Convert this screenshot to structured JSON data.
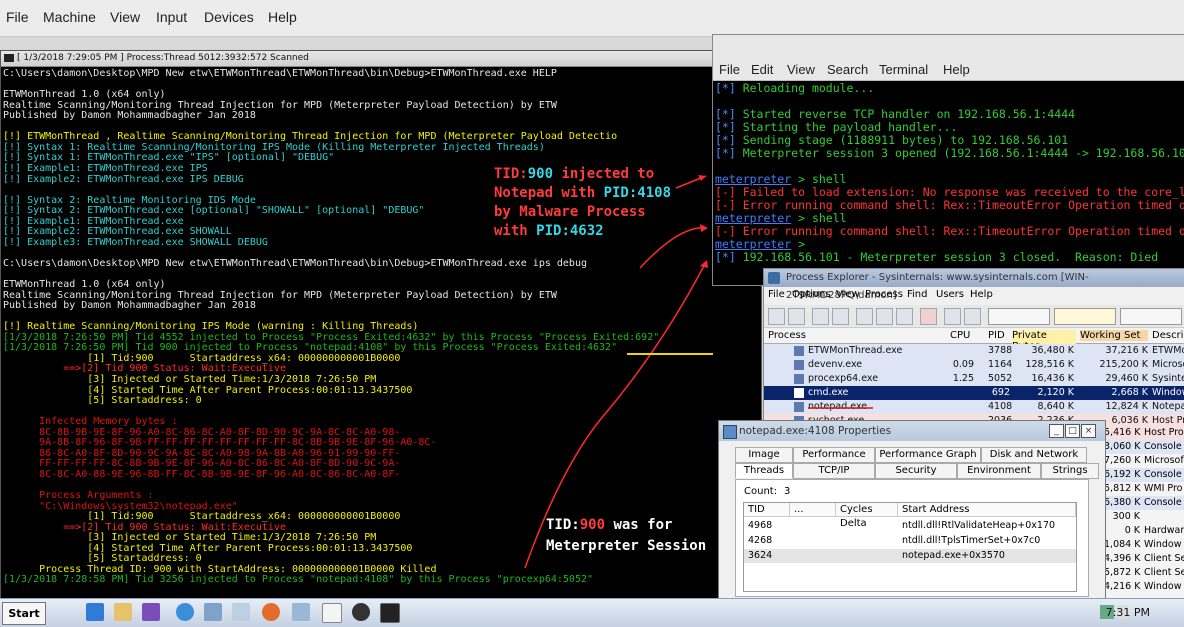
{
  "host_menu": [
    "File",
    "Machine",
    "View",
    "Input",
    "Devices",
    "Help"
  ],
  "cmd": {
    "title": "[ 1/3/2018 7:29:05 PM ] Process:Thread 5012:3932:572 Scanned",
    "lines": [
      {
        "t": "C:\\Users\\damon\\Desktop\\MPD New etw\\ETWMonThread\\ETWMonThread\\bin\\Debug>ETWMonThread.exe HELP",
        "c": "w"
      },
      {
        "t": "",
        "c": "w"
      },
      {
        "t": "ETWMonThread 1.0 (x64 only)",
        "c": "w"
      },
      {
        "t": "Realtime Scanning/Monitoring Thread Injection for MPD (Meterpreter Payload Detection) by ETW",
        "c": "w"
      },
      {
        "t": "Published by Damon Mohammadbagher Jan 2018",
        "c": "w"
      },
      {
        "t": "",
        "c": "w"
      },
      {
        "t": "[!] ETWMonThread , Realtime Scanning/Monitoring Thread Injection for MPD (Meterpreter Payload Detectio",
        "c": "y"
      },
      {
        "t": "[!] Syntax 1: Realtime Scanning/Monitoring IPS Mode (Killing Meterpreter Injected Threads)",
        "c": "c"
      },
      {
        "t": "[!] Syntax 1: ETWMonThread.exe \"IPS\" [optional] \"DEBUG\"",
        "c": "c"
      },
      {
        "t": "[!] Example1: ETWMonThread.exe IPS",
        "c": "c"
      },
      {
        "t": "[!] Example2: ETWMonThread.exe IPS DEBUG",
        "c": "c"
      },
      {
        "t": "",
        "c": "w"
      },
      {
        "t": "[!] Syntax 2: Realtime Monitoring IDS Mode",
        "c": "c"
      },
      {
        "t": "[!] Syntax 2: ETWMonThread.exe [optional] \"SHOWALL\" [optional] \"DEBUG\"",
        "c": "c"
      },
      {
        "t": "[!] Example1: ETWMonThread.exe",
        "c": "c"
      },
      {
        "t": "[!] Example2: ETWMonThread.exe SHOWALL",
        "c": "c"
      },
      {
        "t": "[!] Example3: ETWMonThread.exe SHOWALL DEBUG",
        "c": "c"
      },
      {
        "t": "",
        "c": "w"
      },
      {
        "t": "C:\\Users\\damon\\Desktop\\MPD New etw\\ETWMonThread\\ETWMonThread\\bin\\Debug>ETWMonThread.exe ips debug",
        "c": "w"
      },
      {
        "t": "",
        "c": "w"
      },
      {
        "t": "ETWMonThread 1.0 (x64 only)",
        "c": "w"
      },
      {
        "t": "Realtime Scanning/Monitoring Thread Injection for MPD (Meterpreter Payload Detection) by ETW",
        "c": "w"
      },
      {
        "t": "Published by Damon Mohammadbagher Jan 2018",
        "c": "w"
      },
      {
        "t": "",
        "c": "w"
      },
      {
        "t": "[!] Realtime Scanning/Monitoring IPS Mode (warning : Killing Threads)",
        "c": "y"
      },
      {
        "t": "[1/3/2018 7:26:50 PM] Tid 4552 injected to Process \"Process Exited:4632\" by this Process \"Process Exited:692\"",
        "c": "g"
      },
      {
        "t": "[1/3/2018 7:26:50 PM] Tid 900 injected to Process \"notepad:4108\" by this Process \"Process Exited:4632\"",
        "c": "g"
      },
      {
        "t": "              [1] Tid:900      Startaddress_x64: 000000000001B0000",
        "c": "y"
      },
      {
        "t": "          ==>[2] Tid 900 Status: Wait:Executive",
        "c": "r"
      },
      {
        "t": "              [3] Injected or Started Time:1/3/2018 7:26:50 PM",
        "c": "y"
      },
      {
        "t": "              [4] Started Time After Parent Process:00:01:13.3437500",
        "c": "y"
      },
      {
        "t": "              [5] Startaddress: 0",
        "c": "y"
      },
      {
        "t": "",
        "c": "w"
      },
      {
        "t": "      Infected Memory bytes :",
        "c": "rd"
      },
      {
        "t": "      8C-8B-9B-9E-8F-96-A0-8C-86-8C-A0-8F-8D-90-9C-9A-8C-8C-A0-98-",
        "c": "rd"
      },
      {
        "t": "      9A-8B-8F-96-8F-9B-FF-FF-FF-FF-FF-FF-FF-FF-8C-8B-9B-9E-8F-96-A0-8C-",
        "c": "rd"
      },
      {
        "t": "      86-8C-A0-8F-8D-90-9C-9A-8C-8C-A0-98-9A-8B-A0-96-91-99-90-FF-",
        "c": "rd"
      },
      {
        "t": "      FF-FF-FF-FF-8C-8B-9B-9E-8F-96-A0-8C-86-8C-A0-8F-8D-90-9C-9A-",
        "c": "rd"
      },
      {
        "t": "      8C-8C-A0-88-9E-96-8B-FF-8C-8B-9B-9E-8F-96-A0-8C-86-8C-A0-8F-",
        "c": "rd"
      },
      {
        "t": "",
        "c": "w"
      },
      {
        "t": "      Process Arguments :",
        "c": "rd"
      },
      {
        "t": "      \"C:\\Windows\\system32\\notepad.exe\"",
        "c": "rd"
      },
      {
        "t": "              [1] Tid:900      Startaddress_x64: 000000000001B0000",
        "c": "y"
      },
      {
        "t": "          ==>[2] Tid 900 Status: Wait:Executive",
        "c": "r"
      },
      {
        "t": "              [3] Injected or Started Time:1/3/2018 7:26:50 PM",
        "c": "y"
      },
      {
        "t": "              [4] Started Time After Parent Process:00:01:13.3437500",
        "c": "y"
      },
      {
        "t": "              [5] Startaddress: 0",
        "c": "y"
      },
      {
        "t": "      Process Thread ID: 900 with StartAddress: 000000000001B0000 Killed",
        "c": "y"
      },
      {
        "t": "[1/3/2018 7:28:58 PM] Tid 3256 injected to Process \"notepad:4108\" by this Process \"procexp64:5052\"",
        "c": "g"
      }
    ]
  },
  "callout_top": {
    "l1a": "TID:",
    "l1b": "900",
    "l1c": " injected to",
    "l2a": "Notepad with ",
    "l2b": "PID:4108",
    "l3": "by Malware Process",
    "l4a": "with ",
    "l4b": "PID:4632"
  },
  "callout_bottom": {
    "l1a": "TID:",
    "l1b": "900",
    "l1c": " was for",
    "l2": "Meterpreter Session"
  },
  "terminal": {
    "menu": [
      "File",
      "Edit",
      "View",
      "Search",
      "Terminal",
      "Help"
    ],
    "lines": [
      {
        "p": "[*]",
        "pc": "tb",
        "t": " Reloading module...",
        "c": "tg"
      },
      {
        "p": "",
        "pc": "tb",
        "t": "",
        "c": "tg"
      },
      {
        "p": "[*]",
        "pc": "tb",
        "t": " Started reverse TCP handler on 192.168.56.1:4444",
        "c": "tg"
      },
      {
        "p": "[*]",
        "pc": "tb",
        "t": " Starting the payload handler...",
        "c": "tg"
      },
      {
        "p": "[*]",
        "pc": "tb",
        "t": " Sending stage (1188911 bytes) to 192.168.56.101",
        "c": "tg"
      },
      {
        "p": "[*]",
        "pc": "tb",
        "t": " Meterpreter session 3 opened (192.168.56.1:4444 -> 192.168.56.10",
        "c": "tg"
      },
      {
        "p": "",
        "pc": "tb",
        "t": "",
        "c": "tg"
      },
      {
        "p": "meterpreter",
        "pc": "tp",
        "t": " > shell",
        "c": "tg"
      },
      {
        "p": "[-]",
        "pc": "tr",
        "t": " Failed to load extension: No response was received to the core_l",
        "c": "tr"
      },
      {
        "p": "[-]",
        "pc": "tr",
        "t": " Error running command shell: Rex::TimeoutError Operation timed o",
        "c": "tr"
      },
      {
        "p": "meterpreter",
        "pc": "tp",
        "t": " > shell",
        "c": "tg"
      },
      {
        "p": "[-]",
        "pc": "tr",
        "t": " Error running command shell: Rex::TimeoutError Operation timed o",
        "c": "tr"
      },
      {
        "p": "meterpreter",
        "pc": "tp",
        "t": " >",
        "c": "tg"
      },
      {
        "p": "[*]",
        "pc": "tb",
        "t": " 192.168.56.101 - Meterpreter session 3 closed.  Reason: Died",
        "c": "tg"
      }
    ]
  },
  "procexp": {
    "title": "Process Explorer - Sysinternals: www.sysinternals.com [WIN-2T9RMD28PQ\\damon]",
    "menu": [
      "File",
      "Options",
      "View",
      "Process",
      "Find",
      "Users",
      "Help"
    ],
    "headers": [
      "Process",
      "CPU",
      "PID",
      "Private Bytes",
      "Working Set",
      "Descrip"
    ],
    "rows": [
      {
        "name": "ETWMonThread.exe",
        "cpu": "",
        "pid": "3788",
        "priv": "36,480 K",
        "ws": "37,216 K",
        "desc": "ETWMon",
        "bg": "#dde4f4"
      },
      {
        "name": "devenv.exe",
        "cpu": "0.09",
        "pid": "1164",
        "priv": "128,516 K",
        "ws": "215,200 K",
        "desc": "Microsof",
        "bg": "#dde4f4"
      },
      {
        "name": "procexp64.exe",
        "cpu": "1.25",
        "pid": "5052",
        "priv": "16,436 K",
        "ws": "29,460 K",
        "desc": "Sysinterr",
        "bg": "#dde4f4"
      },
      {
        "name": "cmd.exe",
        "cpu": "",
        "pid": "692",
        "priv": "2,120 K",
        "ws": "2,668 K",
        "desc": "Window",
        "bg": "#0a246a"
      },
      {
        "name": "notepad.exe",
        "cpu": "",
        "pid": "4108",
        "priv": "8,640 K",
        "ws": "12,824 K",
        "desc": "Notepad",
        "bg": "#dde4f4"
      },
      {
        "name": "svchost.exe",
        "cpu": "",
        "pid": "2036",
        "priv": "2,236 K",
        "ws": "6,036 K",
        "desc": "Host Pro",
        "bg": "#f7e0e0"
      }
    ],
    "extra_rows": [
      {
        "ws": "5,416 K",
        "desc": "Host Pro"
      },
      {
        "ws": "3,060 K",
        "desc": "Console"
      },
      {
        "ws": "7,260 K",
        "desc": "Microsof"
      },
      {
        "ws": "6,192 K",
        "desc": "Console"
      },
      {
        "ws": "5,812 K",
        "desc": "WMI Pro"
      },
      {
        "ws": "6,380 K",
        "desc": "Console"
      },
      {
        "ws": "300 K",
        "desc": ""
      },
      {
        "ws": "0 K",
        "desc": "Hardwar"
      },
      {
        "ws": "1,084 K",
        "desc": "Window"
      },
      {
        "ws": "4,396 K",
        "desc": "Client Se"
      },
      {
        "ws": "5,872 K",
        "desc": "Client Se"
      },
      {
        "ws": "4,216 K",
        "desc": "Window"
      }
    ]
  },
  "notepad_props": {
    "title": "notepad.exe:4108 Properties",
    "tabs_row1": [
      "Image",
      "Performance",
      "Performance Graph",
      "Disk and Network"
    ],
    "tabs_row2": [
      "Threads",
      "TCP/IP",
      "Security",
      "Environment",
      "Strings"
    ],
    "count_label": "Count:",
    "count_value": "3",
    "headers": [
      "TID",
      "...",
      "Cycles Delta",
      "Start Address"
    ],
    "rows": [
      {
        "tid": "4968",
        "addr": "ntdll.dll!RtlValidateHeap+0x170"
      },
      {
        "tid": "4268",
        "addr": "ntdll.dll!TplsTimerSet+0x7c0"
      },
      {
        "tid": "3624",
        "addr": "notepad.exe+0x3570"
      }
    ]
  },
  "taskbar": {
    "start": "Start",
    "time": "7:31 PM"
  }
}
